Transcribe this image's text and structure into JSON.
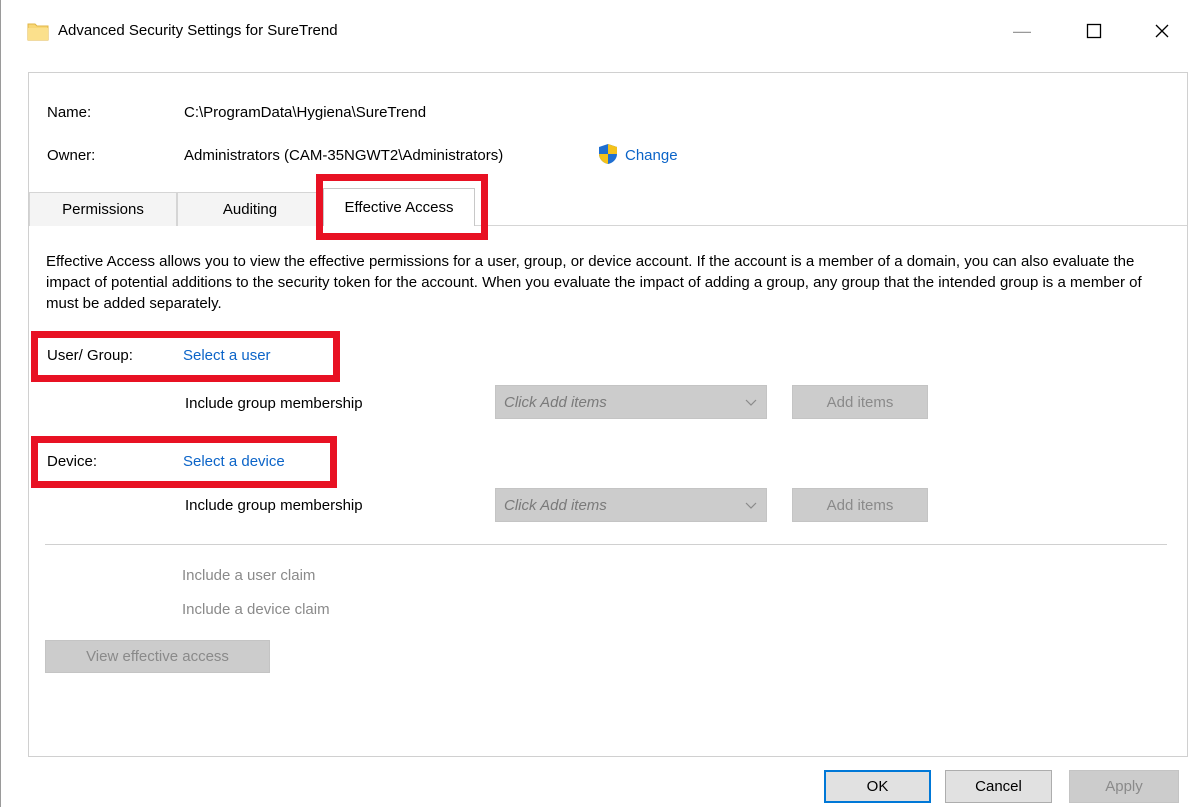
{
  "window": {
    "title": "Advanced Security Settings for SureTrend",
    "minimize": "—",
    "maximize": "☐",
    "close": "✕"
  },
  "info": {
    "name_label": "Name:",
    "name_value": "C:\\ProgramData\\Hygiena\\SureTrend",
    "owner_label": "Owner:",
    "owner_value": "Administrators (CAM-35NGWT2\\Administrators)",
    "change_link": "Change"
  },
  "tabs": [
    {
      "label": "Permissions",
      "active": false
    },
    {
      "label": "Auditing",
      "active": false
    },
    {
      "label": "Effective Access",
      "active": true
    }
  ],
  "description": "Effective Access allows you to view the effective permissions for a user, group, or device account. If the account is a member of a domain, you can also evaluate the impact of potential additions to the security token for the account. When you evaluate the impact of adding a group, any group that the intended group is a member of must be added separately.",
  "user": {
    "label": "User/ Group:",
    "link": "Select a user",
    "membership_label": "Include group membership",
    "combo_value": "Click Add items",
    "add_button": "Add items"
  },
  "device": {
    "label": "Device:",
    "link": "Select a device",
    "membership_label": "Include group membership",
    "combo_value": "Click Add items",
    "add_button": "Add items"
  },
  "claims": {
    "user_claim": "Include a user claim",
    "device_claim": "Include a device claim"
  },
  "view_button": "View effective access",
  "footer": {
    "ok": "OK",
    "cancel": "Cancel",
    "apply": "Apply"
  },
  "colors": {
    "link": "#0b64c8",
    "highlight": "#e81123"
  }
}
